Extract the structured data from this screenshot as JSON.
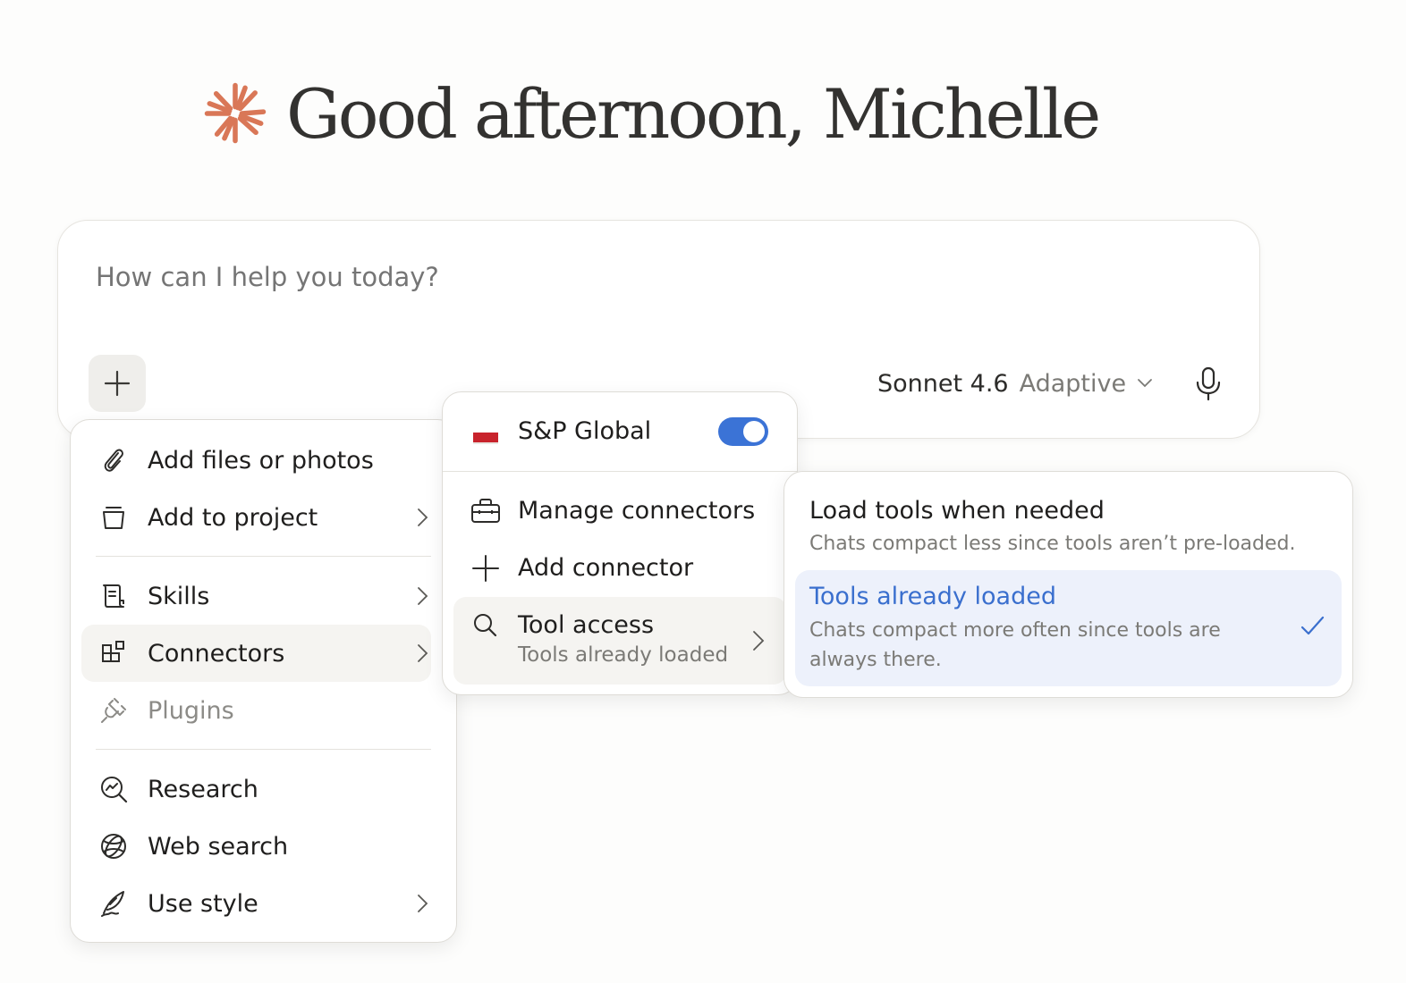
{
  "greeting": {
    "text": "Good afternoon, Michelle"
  },
  "composer": {
    "placeholder": "How can I help you today?",
    "model_name": "Sonnet 4.6",
    "model_mode": "Adaptive"
  },
  "main_menu": {
    "items": [
      {
        "label": "Add files or photos",
        "icon": "paperclip-icon"
      },
      {
        "label": "Add to project",
        "icon": "project-icon"
      },
      {
        "label": "Skills",
        "icon": "skills-icon"
      },
      {
        "label": "Connectors",
        "icon": "connectors-icon"
      },
      {
        "label": "Plugins",
        "icon": "plugin-icon"
      },
      {
        "label": "Research",
        "icon": "research-icon"
      },
      {
        "label": "Web search",
        "icon": "globe-icon"
      },
      {
        "label": "Use style",
        "icon": "feather-icon"
      }
    ]
  },
  "connectors_menu": {
    "sp_global_label": "S&P Global",
    "sp_global_enabled": true,
    "manage_label": "Manage connectors",
    "add_label": "Add connector",
    "tool_access_label": "Tool access",
    "tool_access_value": "Tools already loaded"
  },
  "tool_menu": {
    "options": [
      {
        "title": "Load tools when needed",
        "description": "Chats compact less since tools aren’t pre-loaded."
      },
      {
        "title": "Tools already loaded",
        "description": "Chats compact more often since tools are always there."
      }
    ]
  },
  "colors": {
    "accent": "#3b73d6",
    "brand_star": "#d97757",
    "sp_red": "#c8232c"
  }
}
